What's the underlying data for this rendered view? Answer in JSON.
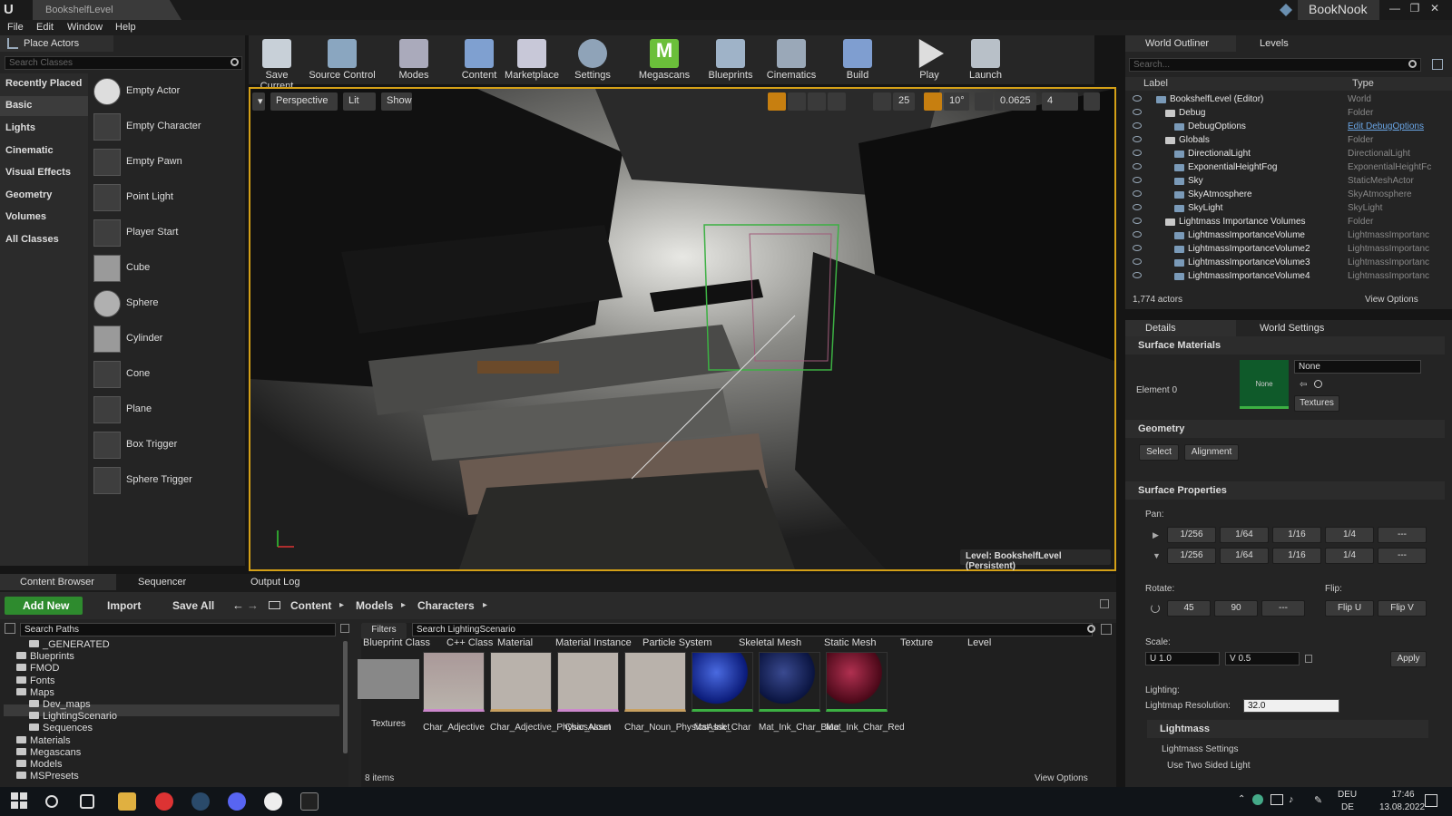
{
  "titlebar": {
    "doc_tab": "BookshelfLevel",
    "project": "BookNook",
    "min": "—",
    "max": "❐",
    "close": "✕"
  },
  "menu": [
    "File",
    "Edit",
    "Window",
    "Help"
  ],
  "place_actors": {
    "tab": "Place Actors",
    "search_placeholder": "Search Classes",
    "categories": [
      "Recently Placed",
      "Basic",
      "Lights",
      "Cinematic",
      "Visual Effects",
      "Geometry",
      "Volumes",
      "All Classes"
    ],
    "actors": [
      "Empty Actor",
      "Empty Character",
      "Empty Pawn",
      "Point Light",
      "Player Start",
      "Cube",
      "Sphere",
      "Cylinder",
      "Cone",
      "Plane",
      "Box Trigger",
      "Sphere Trigger"
    ]
  },
  "toolbar": [
    "Save Current",
    "Source Control",
    "Modes",
    "Content",
    "Marketplace",
    "Settings",
    "Megascans",
    "Blueprints",
    "Cinematics",
    "Build",
    "Play",
    "Launch"
  ],
  "viewport": {
    "perspective": "Perspective",
    "lit": "Lit",
    "show": "Show",
    "grid": "25",
    "angle": "10°",
    "scale": "0.0625",
    "speed": "4",
    "level_label": "Level:  BookshelfLevel (Persistent)"
  },
  "outliner": {
    "tab": "World Outliner",
    "tab2": "Levels",
    "search_placeholder": "Search...",
    "col_label": "Label",
    "col_type": "Type",
    "rows": [
      {
        "name": "BookshelfLevel (Editor)",
        "type": "World"
      },
      {
        "name": "Debug",
        "type": "Folder"
      },
      {
        "name": "DebugOptions",
        "type": "Edit DebugOptions"
      },
      {
        "name": "Globals",
        "type": "Folder"
      },
      {
        "name": "DirectionalLight",
        "type": "DirectionalLight"
      },
      {
        "name": "ExponentialHeightFog",
        "type": "ExponentialHeightFc"
      },
      {
        "name": "Sky",
        "type": "StaticMeshActor"
      },
      {
        "name": "SkyAtmosphere",
        "type": "SkyAtmosphere"
      },
      {
        "name": "SkyLight",
        "type": "SkyLight"
      },
      {
        "name": "Lightmass Importance Volumes",
        "type": "Folder"
      },
      {
        "name": "LightmassImportanceVolume",
        "type": "LightmassImportanc"
      },
      {
        "name": "LightmassImportanceVolume2",
        "type": "LightmassImportanc"
      },
      {
        "name": "LightmassImportanceVolume3",
        "type": "LightmassImportanc"
      },
      {
        "name": "LightmassImportanceVolume4",
        "type": "LightmassImportanc"
      }
    ],
    "count": "1,774 actors",
    "view_options": "View Options"
  },
  "details": {
    "tab": "Details",
    "tab2": "World Settings",
    "surface_materials": "Surface Materials",
    "element0": "Element 0",
    "none_swatch": "None",
    "none_dropdown": "None",
    "textures": "Textures",
    "geometry": "Geometry",
    "select": "Select",
    "alignment": "Alignment",
    "surface_properties": "Surface Properties",
    "pan": "Pan:",
    "pan_values": [
      "1/256",
      "1/64",
      "1/16",
      "1/4",
      "---"
    ],
    "rotate": "Rotate:",
    "rot45": "45",
    "rot90": "90",
    "rotdash": "---",
    "flip": "Flip:",
    "flipu": "Flip U",
    "flipv": "Flip V",
    "scale": "Scale:",
    "u": "U  1.0",
    "v": "V  0.5",
    "apply": "Apply",
    "lighting": "Lighting:",
    "lightmap_res": "Lightmap Resolution:",
    "lightmap_val": "32.0",
    "lightmass": "Lightmass",
    "lightmass_settings": "Lightmass Settings",
    "two_sided": "Use Two Sided Light"
  },
  "content_browser": {
    "tabs": [
      "Content Browser",
      "Sequencer",
      "Output Log"
    ],
    "add_new": "Add New",
    "import": "Import",
    "save_all": "Save All",
    "crumbs": [
      "Content",
      "Models",
      "Characters"
    ],
    "search_paths": "Search Paths",
    "filters": "Filters",
    "search_assets": "Search LightingScenario",
    "tree": [
      "_GENERATED",
      "Blueprints",
      "FMOD",
      "Fonts",
      "Maps",
      "Dev_maps",
      "LightingScenario",
      "Sequences",
      "Materials",
      "Megascans",
      "Models",
      "MSPresets"
    ],
    "filter_chips": [
      "Blueprint Class",
      "C++ Class",
      "Material",
      "Material Instance",
      "Particle System",
      "Skeletal Mesh",
      "Static Mesh",
      "Texture",
      "Level"
    ],
    "assets": [
      "Textures",
      "Char_Adjective",
      "Char_Adjective_PhysicsAsset",
      "Char_Noun",
      "Char_Noun_PhysicsAsset",
      "Mat_Ink_Char",
      "Mat_Ink_Char_Blue",
      "Mat_Ink_Char_Red"
    ],
    "items": "8 items",
    "view_options": "View Options"
  },
  "taskbar": {
    "lang1": "DEU",
    "lang2": "DE",
    "time": "17:46",
    "date": "13.08.2022"
  },
  "colors": {
    "accent_orange": "#d4a017",
    "add_new_green": "#2e8b2e",
    "megascans_green": "#6bbf3a",
    "ink_blue": "#1a3aa8",
    "ink_red": "#8a1020"
  }
}
